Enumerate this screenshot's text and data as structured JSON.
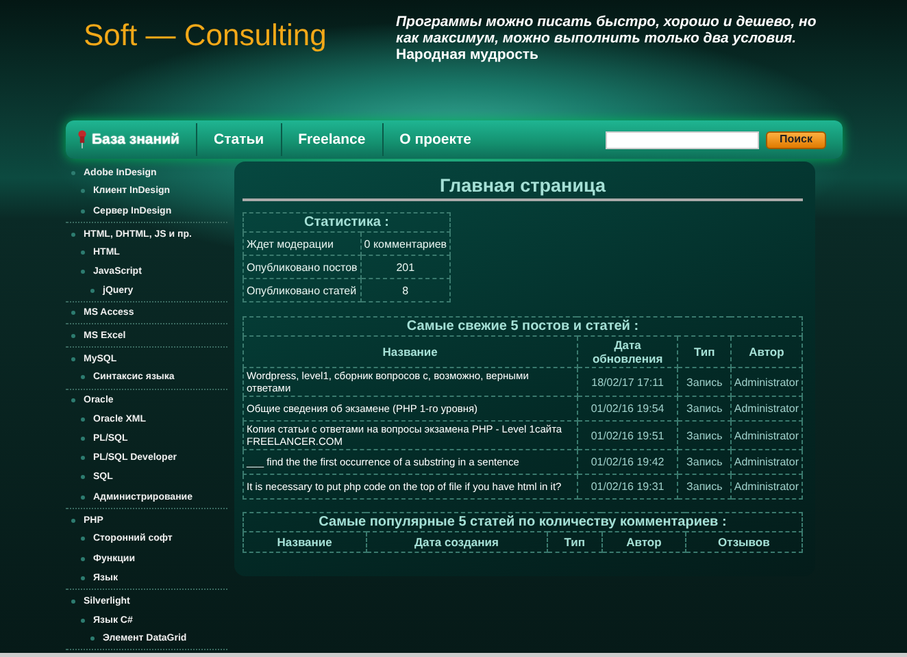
{
  "header": {
    "logo": "Soft — Consulting",
    "quote": "Программы можно писать быстро, хорошо и дешево, но как максимум, можно выполнить только два условия.",
    "quote_source": "Народная мудрость"
  },
  "nav": {
    "items": [
      {
        "label": "База знаний",
        "selected": true
      },
      {
        "label": "Статьи",
        "selected": false
      },
      {
        "label": "Freelance",
        "selected": false
      },
      {
        "label": "О проекте",
        "selected": false
      }
    ],
    "search_button": "Поиск"
  },
  "sidebar": {
    "items": [
      {
        "label": "Adobe InDesign",
        "children": [
          {
            "label": "Клиент InDesign"
          },
          {
            "label": "Сервер InDesign"
          }
        ]
      },
      {
        "label": "HTML, DHTML, JS и пр.",
        "children": [
          {
            "label": "HTML"
          },
          {
            "label": "JavaScript",
            "children": [
              {
                "label": "jQuery"
              }
            ]
          }
        ]
      },
      {
        "label": "MS Access"
      },
      {
        "label": "MS Excel"
      },
      {
        "label": "MySQL",
        "children": [
          {
            "label": "Синтаксис языка"
          }
        ]
      },
      {
        "label": "Oracle",
        "children": [
          {
            "label": "Oracle XML"
          },
          {
            "label": "PL/SQL"
          },
          {
            "label": "PL/SQL Developer"
          },
          {
            "label": "SQL"
          },
          {
            "label": "Администрирование"
          }
        ]
      },
      {
        "label": "PHP",
        "children": [
          {
            "label": "Сторонний софт"
          },
          {
            "label": "Функции"
          },
          {
            "label": "Язык"
          }
        ]
      },
      {
        "label": "Silverlight",
        "children": [
          {
            "label": "Язык C#",
            "children": [
              {
                "label": "Элемент DataGrid"
              }
            ]
          }
        ]
      }
    ]
  },
  "main": {
    "title": "Главная страница",
    "stats": {
      "title": "Статистика :",
      "rows": [
        [
          "Ждет модерации",
          "0 комментариев"
        ],
        [
          "Опубликовано постов",
          "201"
        ],
        [
          "Опубликовано статей",
          "8"
        ]
      ]
    },
    "recent": {
      "title": "Самые свежие 5 постов и статей :",
      "columns": [
        "Название",
        "Дата обновления",
        "Тип",
        "Автор"
      ],
      "rows": [
        [
          "Wordpress, level1, сборник вопросов с, возможно, верными ответами",
          "18/02/17 17:11",
          "Запись",
          "Administrator"
        ],
        [
          "Общие сведения об экзамене (PHP 1-го уровня)",
          "01/02/16 19:54",
          "Запись",
          "Administrator"
        ],
        [
          "Копия статьи с ответами на вопросы экзамена PHP - Level 1сайта FREELANCER.COM",
          "01/02/16 19:51",
          "Запись",
          "Administrator"
        ],
        [
          "___ find the the first occurrence of a substring in a sentence",
          "01/02/16 19:42",
          "Запись",
          "Administrator"
        ],
        [
          "It is necessary to put php code on the top of file if you have html in it?",
          "01/02/16 19:31",
          "Запись",
          "Administrator"
        ]
      ]
    },
    "popular": {
      "title": "Самые популярные 5 статей по количеству комментариев :",
      "columns": [
        "Название",
        "Дата создания",
        "Тип",
        "Автор",
        "Отзывов"
      ]
    }
  }
}
